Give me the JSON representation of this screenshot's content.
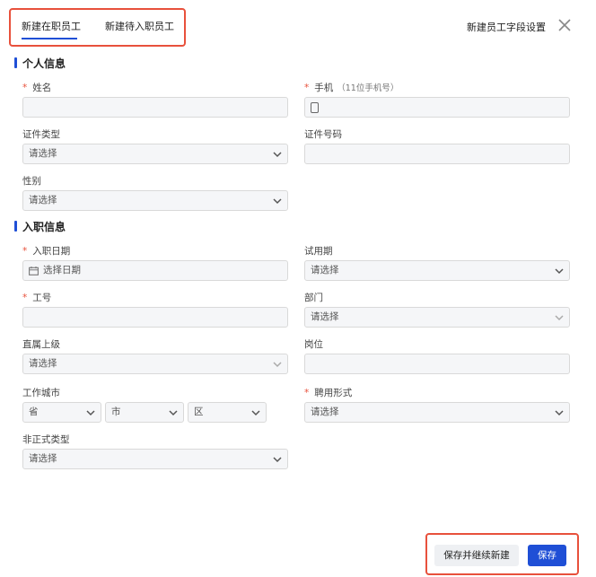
{
  "tabs": [
    {
      "label": "新建在职员工",
      "active": true
    },
    {
      "label": "新建待入职员工",
      "active": false
    }
  ],
  "header": {
    "field_settings_label": "新建员工字段设置",
    "close_icon": "close-icon"
  },
  "colors": {
    "accent": "#1f4fd6",
    "required": "#e8513c",
    "highlight_border": "#e8513c"
  },
  "sections": {
    "personal": {
      "title": "个人信息",
      "name": {
        "label": "姓名",
        "required": true,
        "value": ""
      },
      "phone": {
        "label": "手机",
        "hint": "（11位手机号）",
        "required": true,
        "value": ""
      },
      "id_type": {
        "label": "证件类型",
        "placeholder": "请选择"
      },
      "id_number": {
        "label": "证件号码",
        "value": ""
      },
      "gender": {
        "label": "性别",
        "placeholder": "请选择"
      }
    },
    "employment": {
      "title": "入职信息",
      "hire_date": {
        "label": "入职日期",
        "required": true,
        "placeholder": "选择日期"
      },
      "probation": {
        "label": "试用期",
        "placeholder": "请选择"
      },
      "employee_no": {
        "label": "工号",
        "required": true,
        "value": ""
      },
      "department": {
        "label": "部门",
        "placeholder": "请选择"
      },
      "supervisor": {
        "label": "直属上级",
        "placeholder": "请选择"
      },
      "position": {
        "label": "岗位",
        "value": ""
      },
      "work_city": {
        "label": "工作城市",
        "province": "省",
        "city": "市",
        "district": "区"
      },
      "employment_type": {
        "label": "聘用形式",
        "required": true,
        "placeholder": "请选择"
      },
      "informal_type": {
        "label": "非正式类型",
        "placeholder": "请选择"
      }
    }
  },
  "footer": {
    "save_and_new_label": "保存并继续新建",
    "save_label": "保存"
  }
}
